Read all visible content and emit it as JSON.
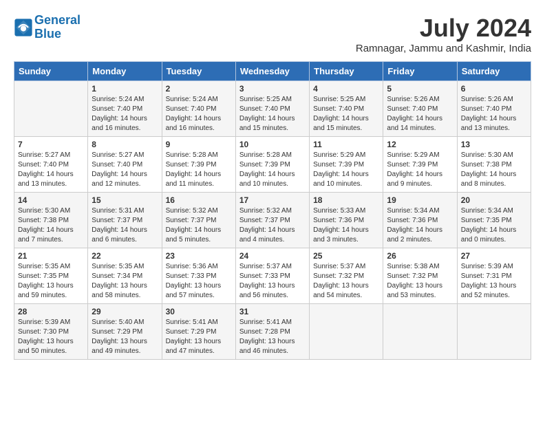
{
  "header": {
    "logo_line1": "General",
    "logo_line2": "Blue",
    "month_title": "July 2024",
    "location": "Ramnagar, Jammu and Kashmir, India"
  },
  "columns": [
    "Sunday",
    "Monday",
    "Tuesday",
    "Wednesday",
    "Thursday",
    "Friday",
    "Saturday"
  ],
  "weeks": [
    [
      {
        "day": "",
        "info": ""
      },
      {
        "day": "1",
        "info": "Sunrise: 5:24 AM\nSunset: 7:40 PM\nDaylight: 14 hours\nand 16 minutes."
      },
      {
        "day": "2",
        "info": "Sunrise: 5:24 AM\nSunset: 7:40 PM\nDaylight: 14 hours\nand 16 minutes."
      },
      {
        "day": "3",
        "info": "Sunrise: 5:25 AM\nSunset: 7:40 PM\nDaylight: 14 hours\nand 15 minutes."
      },
      {
        "day": "4",
        "info": "Sunrise: 5:25 AM\nSunset: 7:40 PM\nDaylight: 14 hours\nand 15 minutes."
      },
      {
        "day": "5",
        "info": "Sunrise: 5:26 AM\nSunset: 7:40 PM\nDaylight: 14 hours\nand 14 minutes."
      },
      {
        "day": "6",
        "info": "Sunrise: 5:26 AM\nSunset: 7:40 PM\nDaylight: 14 hours\nand 13 minutes."
      }
    ],
    [
      {
        "day": "7",
        "info": "Sunrise: 5:27 AM\nSunset: 7:40 PM\nDaylight: 14 hours\nand 13 minutes."
      },
      {
        "day": "8",
        "info": "Sunrise: 5:27 AM\nSunset: 7:40 PM\nDaylight: 14 hours\nand 12 minutes."
      },
      {
        "day": "9",
        "info": "Sunrise: 5:28 AM\nSunset: 7:39 PM\nDaylight: 14 hours\nand 11 minutes."
      },
      {
        "day": "10",
        "info": "Sunrise: 5:28 AM\nSunset: 7:39 PM\nDaylight: 14 hours\nand 10 minutes."
      },
      {
        "day": "11",
        "info": "Sunrise: 5:29 AM\nSunset: 7:39 PM\nDaylight: 14 hours\nand 10 minutes."
      },
      {
        "day": "12",
        "info": "Sunrise: 5:29 AM\nSunset: 7:39 PM\nDaylight: 14 hours\nand 9 minutes."
      },
      {
        "day": "13",
        "info": "Sunrise: 5:30 AM\nSunset: 7:38 PM\nDaylight: 14 hours\nand 8 minutes."
      }
    ],
    [
      {
        "day": "14",
        "info": "Sunrise: 5:30 AM\nSunset: 7:38 PM\nDaylight: 14 hours\nand 7 minutes."
      },
      {
        "day": "15",
        "info": "Sunrise: 5:31 AM\nSunset: 7:37 PM\nDaylight: 14 hours\nand 6 minutes."
      },
      {
        "day": "16",
        "info": "Sunrise: 5:32 AM\nSunset: 7:37 PM\nDaylight: 14 hours\nand 5 minutes."
      },
      {
        "day": "17",
        "info": "Sunrise: 5:32 AM\nSunset: 7:37 PM\nDaylight: 14 hours\nand 4 minutes."
      },
      {
        "day": "18",
        "info": "Sunrise: 5:33 AM\nSunset: 7:36 PM\nDaylight: 14 hours\nand 3 minutes."
      },
      {
        "day": "19",
        "info": "Sunrise: 5:34 AM\nSunset: 7:36 PM\nDaylight: 14 hours\nand 2 minutes."
      },
      {
        "day": "20",
        "info": "Sunrise: 5:34 AM\nSunset: 7:35 PM\nDaylight: 14 hours\nand 0 minutes."
      }
    ],
    [
      {
        "day": "21",
        "info": "Sunrise: 5:35 AM\nSunset: 7:35 PM\nDaylight: 13 hours\nand 59 minutes."
      },
      {
        "day": "22",
        "info": "Sunrise: 5:35 AM\nSunset: 7:34 PM\nDaylight: 13 hours\nand 58 minutes."
      },
      {
        "day": "23",
        "info": "Sunrise: 5:36 AM\nSunset: 7:33 PM\nDaylight: 13 hours\nand 57 minutes."
      },
      {
        "day": "24",
        "info": "Sunrise: 5:37 AM\nSunset: 7:33 PM\nDaylight: 13 hours\nand 56 minutes."
      },
      {
        "day": "25",
        "info": "Sunrise: 5:37 AM\nSunset: 7:32 PM\nDaylight: 13 hours\nand 54 minutes."
      },
      {
        "day": "26",
        "info": "Sunrise: 5:38 AM\nSunset: 7:32 PM\nDaylight: 13 hours\nand 53 minutes."
      },
      {
        "day": "27",
        "info": "Sunrise: 5:39 AM\nSunset: 7:31 PM\nDaylight: 13 hours\nand 52 minutes."
      }
    ],
    [
      {
        "day": "28",
        "info": "Sunrise: 5:39 AM\nSunset: 7:30 PM\nDaylight: 13 hours\nand 50 minutes."
      },
      {
        "day": "29",
        "info": "Sunrise: 5:40 AM\nSunset: 7:29 PM\nDaylight: 13 hours\nand 49 minutes."
      },
      {
        "day": "30",
        "info": "Sunrise: 5:41 AM\nSunset: 7:29 PM\nDaylight: 13 hours\nand 47 minutes."
      },
      {
        "day": "31",
        "info": "Sunrise: 5:41 AM\nSunset: 7:28 PM\nDaylight: 13 hours\nand 46 minutes."
      },
      {
        "day": "",
        "info": ""
      },
      {
        "day": "",
        "info": ""
      },
      {
        "day": "",
        "info": ""
      }
    ]
  ]
}
